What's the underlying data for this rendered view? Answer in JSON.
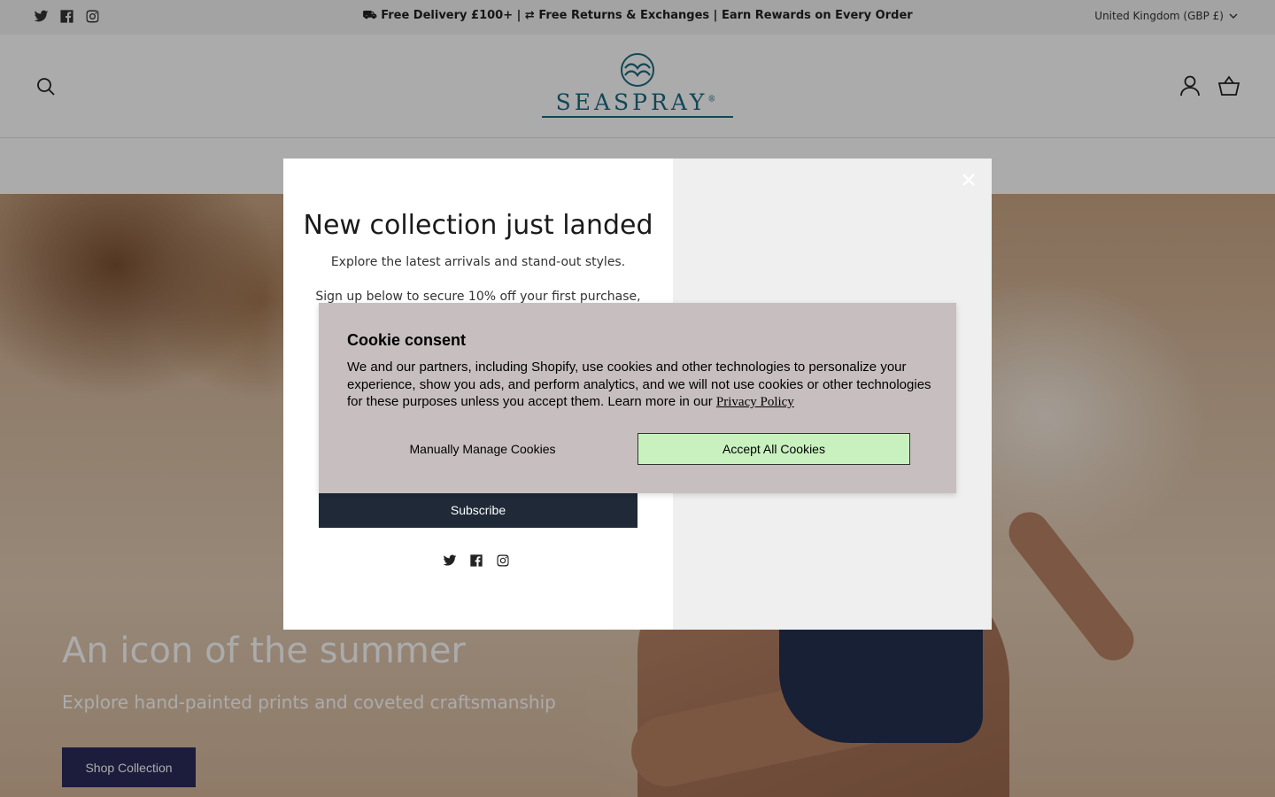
{
  "announcement": {
    "text": "⛟ Free Delivery £100+ | ⇄ Free Returns & Exchanges |   Earn Rewards on Every Order",
    "social_icons": [
      "twitter-icon",
      "facebook-icon",
      "instagram-icon"
    ]
  },
  "region": {
    "label": "United Kingdom (GBP £)"
  },
  "header": {
    "logo_text": "SEASPRAY",
    "logo_mark": "®",
    "icons": [
      "search-icon",
      "account-icon",
      "cart-icon"
    ]
  },
  "hero": {
    "title": "An icon of the summer",
    "subtitle": "Explore hand-painted prints and coveted craftsmanship",
    "button": "Shop Collection"
  },
  "popup": {
    "title": "New collection just landed",
    "description": "Explore the latest arrivals and stand-out styles.",
    "description2": "Sign up below to secure 10% off your first purchase,",
    "subscribe_button": "Subscribe",
    "close_icon": "close-icon"
  },
  "cookie": {
    "title": "Cookie consent",
    "text": "We and our partners, including Shopify, use cookies and other technologies to personalize your experience, show you ads, and perform analytics, and we will not use cookies or other technologies for these purposes unless you accept them. Learn more in our",
    "privacy_link": "Privacy Policy",
    "manage_button": "Manually Manage Cookies",
    "accept_button": "Accept All Cookies",
    "accept_color": "#c9f1c0"
  },
  "colors": {
    "brand": "#1c6a80",
    "subscribe_bg": "#1f2937",
    "hero_button_bg": "#2a2a5a"
  }
}
